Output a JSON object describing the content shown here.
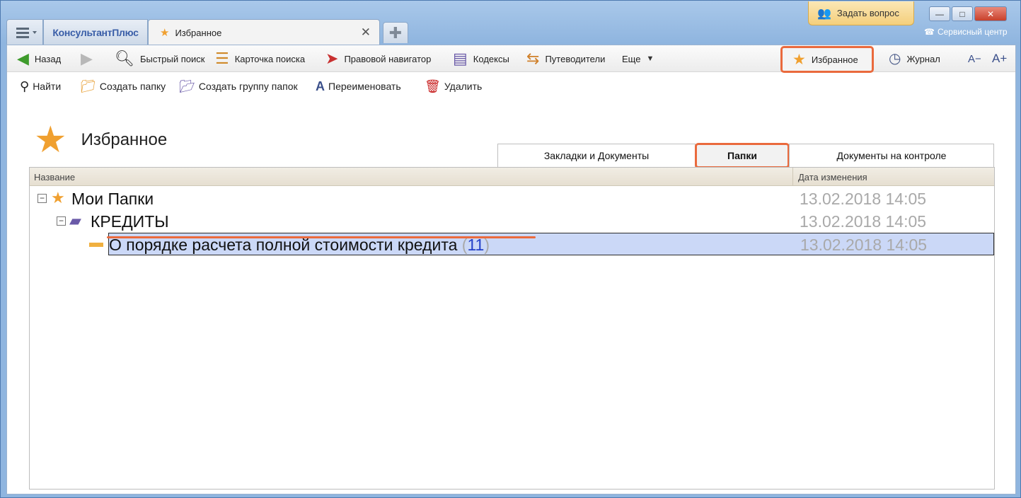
{
  "window": {
    "brand": "КонсультантПлюс",
    "active_tab": "Избранное",
    "new_tab_symbol": "✚",
    "ask_question": "Задать вопрос",
    "service_center": "Сервисный центр",
    "controls": {
      "minimize": "—",
      "maximize": "□",
      "close": "✕"
    }
  },
  "toolbar": {
    "back": "Назад",
    "quick_search": "Быстрый поиск",
    "search_card": "Карточка поиска",
    "legal_navigator": "Правовой навигатор",
    "codes": "Кодексы",
    "guides": "Путеводители",
    "more": "Еще",
    "favorites": "Избранное",
    "journal": "Журнал",
    "font_minus": "A−",
    "font_plus": "A+"
  },
  "actions": {
    "find": "Найти",
    "create_folder": "Создать папку",
    "create_folder_group": "Создать группу папок",
    "rename": "Переименовать",
    "delete": "Удалить"
  },
  "page": {
    "title": "Избранное"
  },
  "tabs": [
    {
      "label": "Закладки и Документы",
      "selected": false
    },
    {
      "label": "Папки",
      "selected": true
    },
    {
      "label": "Документы на контроле",
      "selected": false
    }
  ],
  "grid": {
    "columns": {
      "name": "Название",
      "date": "Дата изменения"
    },
    "rows": [
      {
        "label": "Мои Папки",
        "date": "13.02.2018 14:05",
        "level": 0,
        "expander": "−",
        "icon": "star-icon"
      },
      {
        "label": "КРЕДИТЫ",
        "date": "13.02.2018 14:05",
        "level": 1,
        "expander": "−",
        "icon": "folder-group-icon"
      },
      {
        "label": "О порядке расчета полной стоимости кредита",
        "count": "11",
        "open_paren": "(",
        "close_paren": ")",
        "date": "13.02.2018 14:05",
        "level": 2,
        "icon": "folder-icon",
        "selected": true
      }
    ]
  },
  "colors": {
    "accent": "#ea6a3d",
    "star": "#f0a030",
    "selection": "#cbd8f7",
    "count": "#2340c8"
  }
}
